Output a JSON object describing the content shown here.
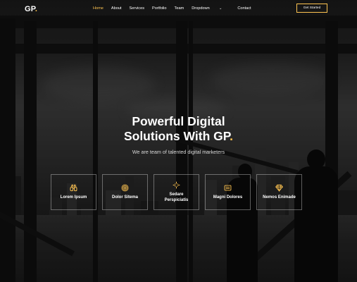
{
  "brand": {
    "name": "GP",
    "dot": "."
  },
  "nav": {
    "items": [
      {
        "label": "Home",
        "active": true
      },
      {
        "label": "About"
      },
      {
        "label": "Services"
      },
      {
        "label": "Portfolio"
      },
      {
        "label": "Team"
      },
      {
        "label": "Dropdown"
      },
      {
        "label": "Contact"
      }
    ],
    "cta": "Get Started"
  },
  "hero": {
    "title_line1": "Powerful Digital",
    "title_line2": "Solutions With GP",
    "title_dot": ".",
    "subtitle": "We are team of talented digital marketers"
  },
  "icon_boxes": [
    {
      "label": "Lorem Ipsum",
      "icon": "binoculars-icon"
    },
    {
      "label": "Dolor Sitema",
      "icon": "bullseye-icon"
    },
    {
      "label": "Sedare Perspiciatis",
      "icon": "calendar-4-week-icon"
    },
    {
      "label": "Magni Dolores",
      "icon": "paint-bucket-icon"
    },
    {
      "label": "Nemos Enimade",
      "icon": "gem-icon"
    }
  ],
  "colors": {
    "accent": "#ffc451",
    "background": "#151515"
  }
}
